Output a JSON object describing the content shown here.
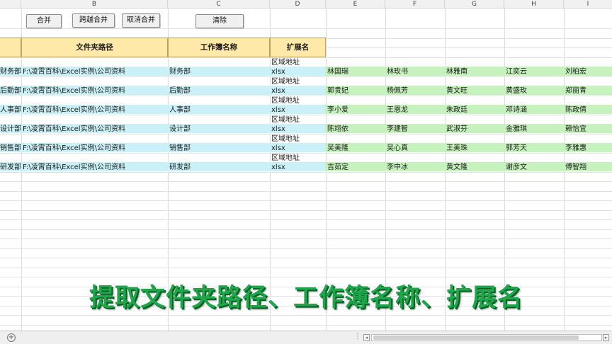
{
  "columns": [
    "B",
    "C",
    "D",
    "E",
    "F",
    "G",
    "H",
    "I"
  ],
  "buttons": {
    "merge": "合并",
    "cross_merge": "跨越合并",
    "unmerge": "取消合并",
    "clear": "清除"
  },
  "header": {
    "folder_path": "文件夹路径",
    "workbook_name": "工作簿名称",
    "extension": "扩展名"
  },
  "rows": [
    {
      "dept_partial": "财务部",
      "path": "F:\\凌霄百科\\Excel实例\\公司资料",
      "name": "财务部",
      "ext_top": "区域地址",
      "ext": "xlsx",
      "names": [
        "林国瑞",
        "林玫书",
        "林雅南",
        "江奕云",
        "刘柏宏"
      ]
    },
    {
      "dept_partial": "后勤部",
      "path": "F:\\凌霄百科\\Excel实例\\公司资料",
      "name": "后勤部",
      "ext_top": "区域地址",
      "ext": "xlsx",
      "names": [
        "郭贵妃",
        "杨佩芳",
        "黄文旺",
        "黄盛玫",
        "郑丽青"
      ]
    },
    {
      "dept_partial": "人事部",
      "path": "F:\\凌霄百科\\Excel实例\\公司资料",
      "name": "人事部",
      "ext_top": "区域地址",
      "ext": "xlsx",
      "names": [
        "李小爱",
        "王恩龙",
        "朱政廷",
        "邓诗涵",
        "陈政倩"
      ]
    },
    {
      "dept_partial": "设计部",
      "path": "F:\\凌霄百科\\Excel实例\\公司资料",
      "name": "设计部",
      "ext_top": "区域地址",
      "ext": "xlsx",
      "names": [
        "陈翊依",
        "李建智",
        "武淑芬",
        "金雅琪",
        "赖怡宜"
      ]
    },
    {
      "dept_partial": "销售部",
      "path": "F:\\凌霄百科\\Excel实例\\公司资料",
      "name": "销售部",
      "ext_top": "区域地址",
      "ext": "xlsx",
      "names": [
        "吴美隆",
        "吴心真",
        "王美珠",
        "郭芳天",
        "李雅惠"
      ]
    },
    {
      "dept_partial": "研发部",
      "path": "F:\\凌霄百科\\Excel实例\\公司资料",
      "name": "研发部",
      "ext_top": "区域地址",
      "ext": "xlsx",
      "names": [
        "吉茹定",
        "李中冰",
        "黄文隆",
        "谢彦文",
        "傅智翔"
      ]
    }
  ],
  "caption": "提取文件夹路径、工作簿名称、扩展名",
  "colors": {
    "header_fill": "#ffe9a8",
    "row_blue": "#c9f1f7",
    "row_green": "#c6f2bd",
    "caption": "#1fa64a"
  },
  "icons": {
    "add_sheet": "plus-circle-icon",
    "scroll_left": "triangle-left-icon",
    "scroll_right": "triangle-right-icon"
  }
}
